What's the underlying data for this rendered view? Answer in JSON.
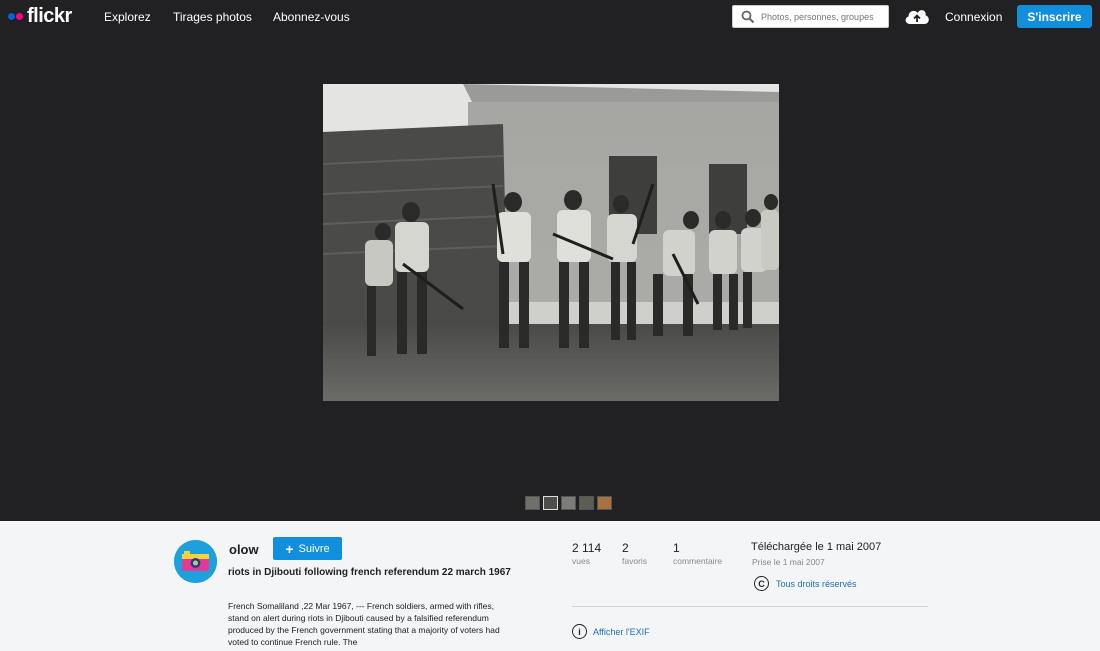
{
  "header": {
    "logo_text": "flickr",
    "nav": [
      "Explorez",
      "Tirages photos",
      "Abonnez-vous"
    ],
    "search_placeholder": "Photos, personnes, groupes",
    "login": "Connexion",
    "signup": "S'inscrire"
  },
  "colors": {
    "brand_blue": "#0063dc",
    "brand_pink": "#ff0084",
    "button_blue": "#128fdc",
    "link_blue": "#1b6fb7",
    "dark_bg": "#212124"
  },
  "photo": {
    "thumb_count": 5
  },
  "owner": {
    "name": "olow",
    "follow_label": "Suivre"
  },
  "photo_info": {
    "title": "riots in Djibouti following french referendum 22 march 1967",
    "description": "French Somaliland ,22 Mar 1967, --- French soldiers, armed with rifles, stand on alert during riots in Djibouti caused by a falsified referendum produced by the French government stating that a majority of voters had voted to continue French rule. The"
  },
  "stats": {
    "views_value": "2 114",
    "views_label": "vues",
    "favs_value": "2",
    "favs_label": "favoris",
    "comments_value": "1",
    "comments_label": "commentaire"
  },
  "dates": {
    "uploaded": "Téléchargée le 1 mai 2007",
    "taken": "Prise le 1 mai 2007"
  },
  "license": {
    "icon_glyph": "C",
    "label": "Tous droits réservés"
  },
  "exif": {
    "icon_glyph": "i",
    "label": "Afficher l'EXIF"
  }
}
